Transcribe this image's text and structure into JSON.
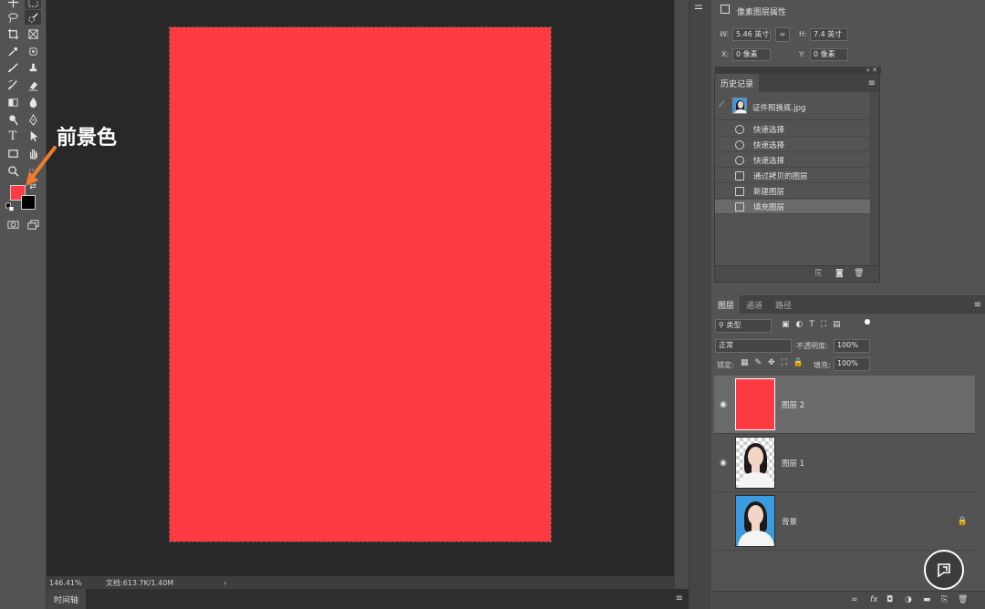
{
  "annotation": {
    "label": "前景色"
  },
  "colors": {
    "foreground": "#fe3a43",
    "background": "#000000",
    "canvas": "#fe3a43",
    "arrow": "#f07b2f"
  },
  "status": {
    "zoom": "146.41%",
    "doc": "文档:613.7K/1.40M"
  },
  "timeline": {
    "tab": "时间轴"
  },
  "properties": {
    "title": "像素图层属性",
    "w_label": "W:",
    "w_value": "5.46 英寸",
    "h_label": "H:",
    "h_value": "7.4 英寸",
    "x_label": "X:",
    "x_value": "0 像素",
    "y_label": "Y:",
    "y_value": "0 像素"
  },
  "history": {
    "tab": "历史记录",
    "snapshot": "证件照换底.jpg",
    "items": [
      {
        "label": "快速选择",
        "icon": "quick-select-icon"
      },
      {
        "label": "快速选择",
        "icon": "quick-select-icon"
      },
      {
        "label": "快速选择",
        "icon": "quick-select-icon"
      },
      {
        "label": "通过拷贝的图层",
        "icon": "layer-doc-icon"
      },
      {
        "label": "新建图层",
        "icon": "layer-doc-icon"
      },
      {
        "label": "填充图层",
        "icon": "layer-doc-icon"
      }
    ]
  },
  "layers_panel": {
    "tabs": [
      "图层",
      "通道",
      "路径"
    ],
    "filter": "类型",
    "blend_mode": "正常",
    "opacity_label": "不透明度:",
    "opacity_value": "100%",
    "lock_label": "锁定:",
    "fill_label": "填充:",
    "fill_value": "100%",
    "layers": [
      {
        "name": "图层 2",
        "visible": true,
        "thumb": "red-fill"
      },
      {
        "name": "图层 1",
        "visible": true,
        "thumb": "portrait-transparent"
      },
      {
        "name": "背景",
        "visible": false,
        "thumb": "portrait-blue",
        "locked": true
      }
    ]
  }
}
